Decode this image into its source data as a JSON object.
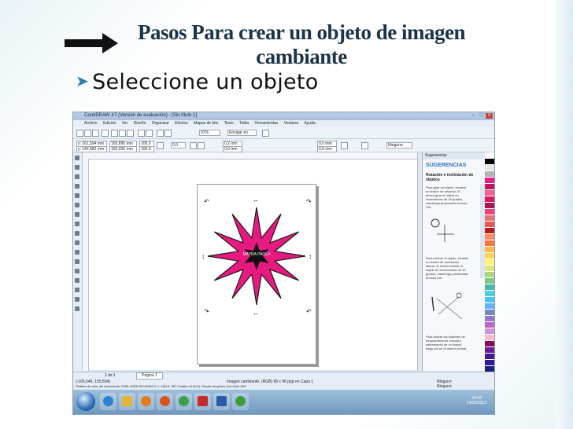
{
  "slide": {
    "title_line1": "Pasos Para crear un objeto de imagen",
    "title_line2": "cambiante",
    "bullet": "Seleccione un objeto"
  },
  "app": {
    "window_title": "CorelDRAW X7 (Versión de evaluación) - [Sin título-1]",
    "menu": [
      "Archivo",
      "Edición",
      "Ver",
      "Diseño",
      "Organizar",
      "Efectos",
      "Mapas de bits",
      "Texto",
      "Tabla",
      "Herramientas",
      "Ventana",
      "Ayuda"
    ],
    "toolbar": {
      "zoom": "97%",
      "snap": "Encajar en",
      "x": "x: 161,594 mm",
      "y": "y: 142,482 mm",
      "w": "165,895 mm",
      "h": "163,026 mm",
      "scale_x": "100,0",
      "scale_y": "100,0",
      "angle": "0,0",
      "outline": "0,2 mm",
      "offset1": "0,0 mm",
      "offset2": "0,0 mm",
      "none_label": "Ninguno"
    },
    "star_text": "MAYRA PAOLA",
    "docker": {
      "tab": "Sugerencias",
      "title": "SUGERENCIAS",
      "subtitle": "Rotación e inclinación de objetos",
      "tip1": "Para girar un objeto, arrastre un tirador de rotación. Si desea girar el objeto en incrementos de 15 grados, mantenga presionada la tecla Ctrl.",
      "tip2": "Para inclinar el objeto, arrastre un tirador de inclinación lateral. Si desea inclinar el objeto en incrementos de 15 grados, mantenga presionada la tecla Ctrl.",
      "tip3": "Para activar los tiradores de desplazamiento, escala y estiramiento de un objeto, haga clic en el tirador central."
    },
    "status": {
      "coords": "(-165,546; 155,654)",
      "page_counter": "1 de 1",
      "page_tab": "Página 1",
      "object_info": "Imagen cambiante: (RGB) 96 x 96 ppp en Capa 1",
      "color_profile": "Perfiles de color del documento: RGB: sRGB IEC61966-2.1; CMYK: ISO Coated v2 (ECI); Escala de grises: Dot Gain 15%",
      "fill_label": "Ninguno",
      "outline_label": "Ninguno"
    },
    "clock": {
      "time": "20:43",
      "date": "14/05/2012"
    }
  },
  "palette_colors": [
    "#ffffff",
    "#000000",
    "#e6e6e6",
    "#b3b3b3",
    "#e91e8c",
    "#c2185b",
    "#f06292",
    "#d81b60",
    "#ad1457",
    "#ec407a",
    "#e57373",
    "#ef5350",
    "#b71c1c",
    "#ff8a65",
    "#ff7043",
    "#ffb74d",
    "#ffd54f",
    "#fff176",
    "#dce775",
    "#aed581",
    "#81c784",
    "#4db6ac",
    "#4dd0e1",
    "#4fc3f7",
    "#64b5f6",
    "#7986cb",
    "#9575cd",
    "#ba68c8",
    "#ce93d8",
    "#f8bbd0",
    "#880e4f",
    "#6a1b9a",
    "#4a148c",
    "#311b92",
    "#1a237e",
    "#0d47a1",
    "#006064",
    "#1b5e20",
    "#33691e",
    "#827717"
  ]
}
